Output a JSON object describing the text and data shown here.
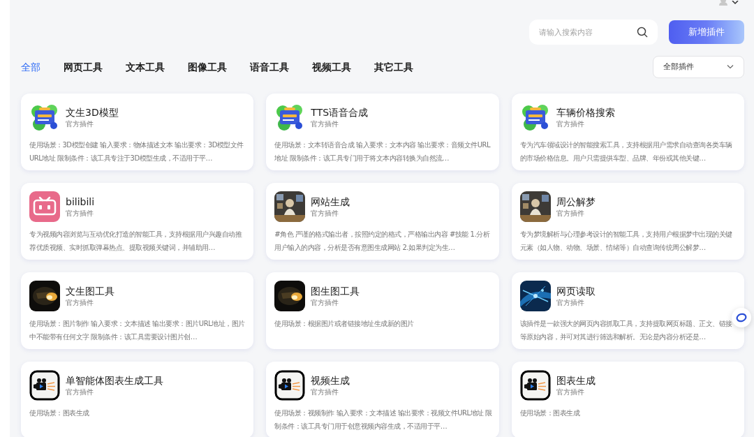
{
  "search": {
    "placeholder": "请输入搜索内容"
  },
  "add_button": "新增插件",
  "tabs": [
    {
      "label": "全部",
      "selected": true
    },
    {
      "label": "网页工具",
      "selected": false
    },
    {
      "label": "文本工具",
      "selected": false
    },
    {
      "label": "图像工具",
      "selected": false
    },
    {
      "label": "语音工具",
      "selected": false
    },
    {
      "label": "视频工具",
      "selected": false
    },
    {
      "label": "其它工具",
      "selected": false
    }
  ],
  "filter": {
    "value": "全部插件"
  },
  "plugins": [
    {
      "name": "文生3D模型",
      "tag": "官方插件",
      "kind": "toolbox",
      "description": "使用场景：3D模型创建 输入要求：物体描述文本 输出要求：3D模型文件URL地址 限制条件：该工具专注于3D模型生成，不适用于平…"
    },
    {
      "name": "TTS语音合成",
      "tag": "官方插件",
      "kind": "toolbox",
      "description": "使用场景：文本转语音合成 输入要求：文本内容 输出要求：音频文件URL地址 限制条件：该工具专门用于将文本内容转换为自然流…"
    },
    {
      "name": "车辆价格搜索",
      "tag": "官方插件",
      "kind": "toolbox",
      "description": "专为汽车领域设计的智能搜索工具，支持根据用户需求自动查询各类车辆的市场价格信息。用户只需提供车型、品牌、年份或其他关键…"
    },
    {
      "name": "bilibili",
      "tag": "官方插件",
      "kind": "tv",
      "description": "专为视频内容浏览与互动优化打造的智能工具，支持根据用户兴趣自动推荐优质视频、实时抓取弹幕热点、提取视频关键词，并辅助用…"
    },
    {
      "name": "网站生成",
      "tag": "官方插件",
      "kind": "portrait",
      "description": "#角色 严谨的格式输出者，按照约定的格式，严格输出内容 #技能 1.分析用户输入的内容，分析是否有意图生成网站 2.如果判定为生…"
    },
    {
      "name": "周公解梦",
      "tag": "官方插件",
      "kind": "portrait",
      "description": "专为梦境解析与心理参考设计的智能工具，支持用户根据梦中出现的关键元素（如人物、动物、场景、情绪等）自动查询传统周公解梦…"
    },
    {
      "name": "文生图工具",
      "tag": "官方插件",
      "kind": "ember",
      "description": "使用场景：图片制作 输入要求：文本描述 输出要求：图片URL地址，图片中不能带有任何文字 限制条件：该工具需要设计图片创…"
    },
    {
      "name": "图生图工具",
      "tag": "官方插件",
      "kind": "ember",
      "description": "使用场景：根据图片或者链接地址生成新的图片"
    },
    {
      "name": "网页读取",
      "tag": "官方插件",
      "kind": "network",
      "description": "该插件是一款强大的网页内容抓取工具，支持提取网页标题、正文、链接等原始内容，并可对其进行筛选和解析。无论是内容分析还是…"
    },
    {
      "name": "单智能体图表生成工具",
      "tag": "官方插件",
      "kind": "camera",
      "description": "使用场景：图表生成"
    },
    {
      "name": "视频生成",
      "tag": "官方插件",
      "kind": "camera",
      "description": "使用场景：视频制作 输入要求：文本描述 输出要求：视频文件URL地址 限制条件：该工具专门用于创意视频内容生成，不适用于平…"
    },
    {
      "name": "图表生成",
      "tag": "官方插件",
      "kind": "camera",
      "description": "使用场景：图表生成"
    }
  ]
}
